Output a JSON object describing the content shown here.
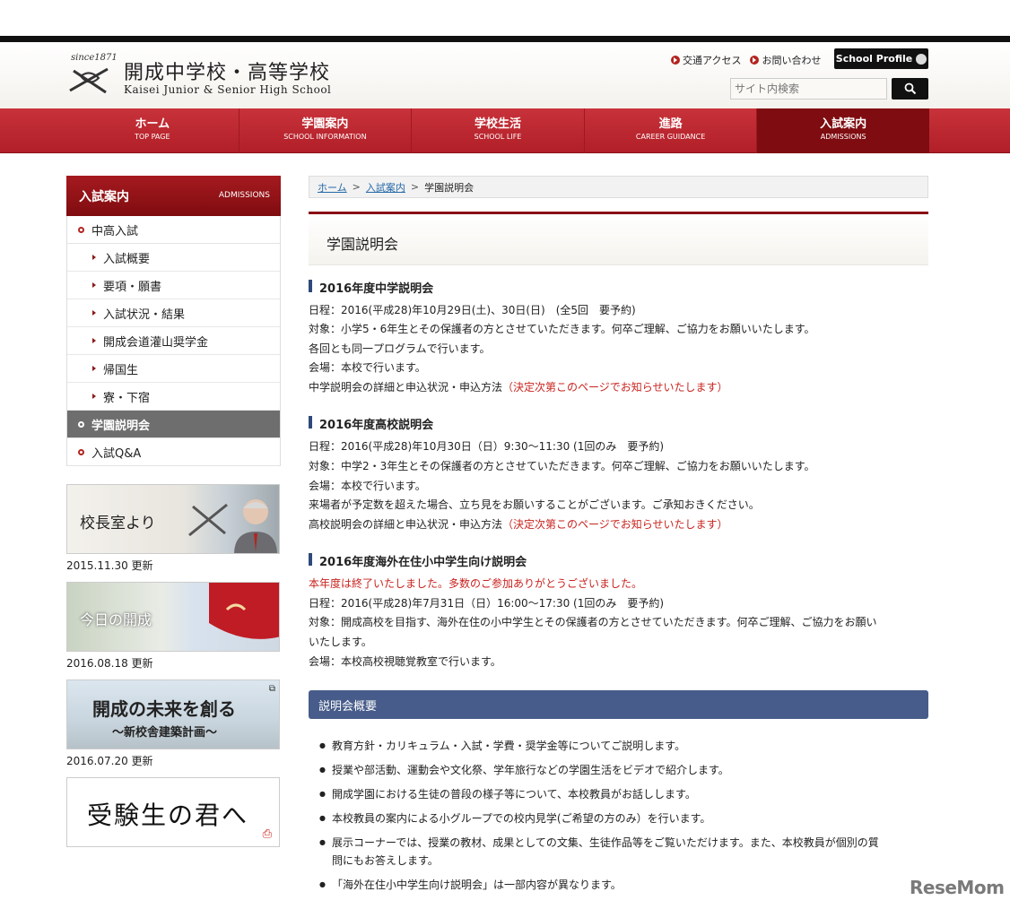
{
  "header": {
    "since": "since1871",
    "school_name_jp": "開成中学校・高等学校",
    "school_name_en": "Kaisei Junior & Senior High School",
    "links": [
      {
        "label": "交通アクセス"
      },
      {
        "label": "お問い合わせ"
      }
    ],
    "profile_button": "School Profile",
    "search_placeholder": "サイト内検索"
  },
  "global_nav": [
    {
      "jp": "ホーム",
      "en": "TOP PAGE",
      "active": false
    },
    {
      "jp": "学園案内",
      "en": "SCHOOL INFORMATION",
      "active": false
    },
    {
      "jp": "学校生活",
      "en": "SCHOOL LIFE",
      "active": false
    },
    {
      "jp": "進路",
      "en": "CAREER GUIDANCE",
      "active": false
    },
    {
      "jp": "入試案内",
      "en": "ADMISSIONS",
      "active": true
    }
  ],
  "sidebar": {
    "title_jp": "入試案内",
    "title_en": "ADMISSIONS",
    "items": [
      {
        "label": "中高入試",
        "level": 1
      },
      {
        "label": "入試概要",
        "level": 2
      },
      {
        "label": "要項・願書",
        "level": 2
      },
      {
        "label": "入試状況・結果",
        "level": 2
      },
      {
        "label": "開成会道灌山奨学金",
        "level": 2
      },
      {
        "label": "帰国生",
        "level": 2
      },
      {
        "label": "寮・下宿",
        "level": 2
      },
      {
        "label": "学園説明会",
        "level": 1,
        "active": true
      },
      {
        "label": "入試Q&A",
        "level": 1
      }
    ],
    "banners": [
      {
        "text": "校長室より",
        "date": "2015.11.30 更新"
      },
      {
        "text": "今日の開成",
        "date": "2016.08.18 更新"
      },
      {
        "text": "開成の未来を創る",
        "sub": "～新校舎建築計画～",
        "date": "2016.07.20 更新"
      },
      {
        "text": "受験生の君へ"
      }
    ]
  },
  "breadcrumb": {
    "home": "ホーム",
    "parent": "入試案内",
    "current": "学園説明会",
    "separator": ">"
  },
  "page_title": "学園説明会",
  "sections": {
    "jh": {
      "heading": "2016年度中学説明会",
      "lines": [
        "日程：2016(平成28)年10月29日(土)、30日(日)　(全5回　要予約)",
        "対象：小学5・6年生とその保護者の方とさせていただきます。何卒ご理解、ご協力をお願いいたします。",
        "各回とも同一プログラムで行います。",
        "会場：本校で行います。"
      ],
      "last_prefix": "中学説明会の詳細と申込状況・申込方法",
      "last_red": "（決定次第このページでお知らせいたします）"
    },
    "hs": {
      "heading": "2016年度高校説明会",
      "lines": [
        "日程：2016(平成28)年10月30日（日）9:30～11:30 (1回のみ　要予約)",
        "対象：中学2・3年生とその保護者の方とさせていただきます。何卒ご理解、ご協力をお願いいたします。",
        "会場：本校で行います。",
        "来場者が予定数を超えた場合、立ち見をお願いすることがございます。ご承知おきください。"
      ],
      "last_prefix": "高校説明会の詳細と申込状況・申込方法",
      "last_red": "（決定次第このページでお知らせいたします）"
    },
    "overseas": {
      "heading": "2016年度海外在住小中学生向け説明会",
      "notice": "本年度は終了いたしました。多数のご参加ありがとうございました。",
      "lines": [
        "日程：2016(平成28)年7月31日（日）16:00～17:30 (1回のみ　要予約)",
        "対象：開成高校を目指す、海外在住の小中学生とその保護者の方とさせていただきます。何卒ご理解、ご協力をお願い",
        "いたします。",
        "会場：本校高校視聴覚教室で行います。"
      ]
    },
    "overview": {
      "heading": "説明会概要",
      "items": [
        "教育方針・カリキュラム・入試・学費・奨学金等についてご説明します。",
        "授業や部活動、運動会や文化祭、学年旅行などの学園生活をビデオで紹介します。",
        "開成学園における生徒の普段の様子等について、本校教員がお話しします。",
        "本校教員の案内による小グループでの校内見学(ご希望の方のみ）を行います。",
        "展示コーナーでは、授業の教材、成果としての文集、生徒作品等をご覧いただけます。また、本校教員が個別の質",
        "問にもお答えします。",
        "「海外在住小中学生向け説明会」は一部内容が異なります。"
      ]
    }
  },
  "watermark": "ReseMom",
  "colors": {
    "brand_red": "#b11f28",
    "dark_red": "#7e0c10",
    "navy": "#475c8a",
    "alert_red": "#c8231e"
  }
}
